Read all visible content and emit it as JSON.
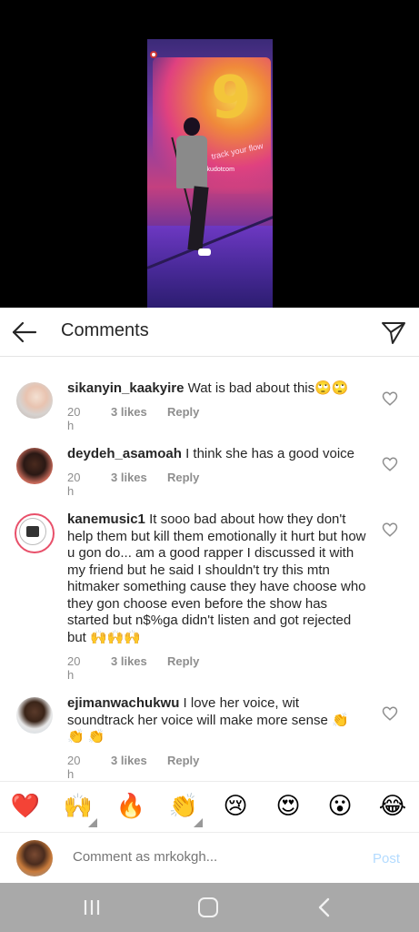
{
  "video": {
    "sign_text": "9",
    "sign_tagline": "track your flow",
    "watermark": "@kwekudotcom"
  },
  "header": {
    "title": "Comments"
  },
  "comments": [
    {
      "username": "sikanyin_kaakyire",
      "text": "Wat is bad about this🙄🙄",
      "time": "20 h",
      "likes": "3 likes",
      "reply": "Reply"
    },
    {
      "username": "deydeh_asamoah",
      "text": "I think she has a good voice",
      "time": "20 h",
      "likes": "3 likes",
      "reply": "Reply"
    },
    {
      "username": "kanemusic1",
      "text": "It sooo bad about how they don't help them but kill them emotionally it hurt but how u gon do... am a good rapper I discussed it with my friend but he said I shouldn't try this mtn hitmaker something cause they have choose who they gon choose even before the show has started but n$%ga didn't listen and got rejected but 🙌🙌🙌",
      "time": "20 h",
      "likes": "3 likes",
      "reply": "Reply"
    },
    {
      "username": "ejimanwachukwu",
      "text": "I love her voice, wit soundtrack her voice will make more sense 👏 👏 👏",
      "time": "20 h",
      "likes": "3 likes",
      "reply": "Reply"
    }
  ],
  "emoji_bar": [
    "❤️",
    "🙌",
    "🔥",
    "👏",
    "😢",
    "😍",
    "😮",
    "😂"
  ],
  "composer": {
    "placeholder": "Comment as mrkokgh...",
    "post_label": "Post"
  },
  "colors": {
    "post_disabled": "#b3dbff",
    "navbar": "#a9a9a9",
    "story_ring": "#e8506a"
  }
}
